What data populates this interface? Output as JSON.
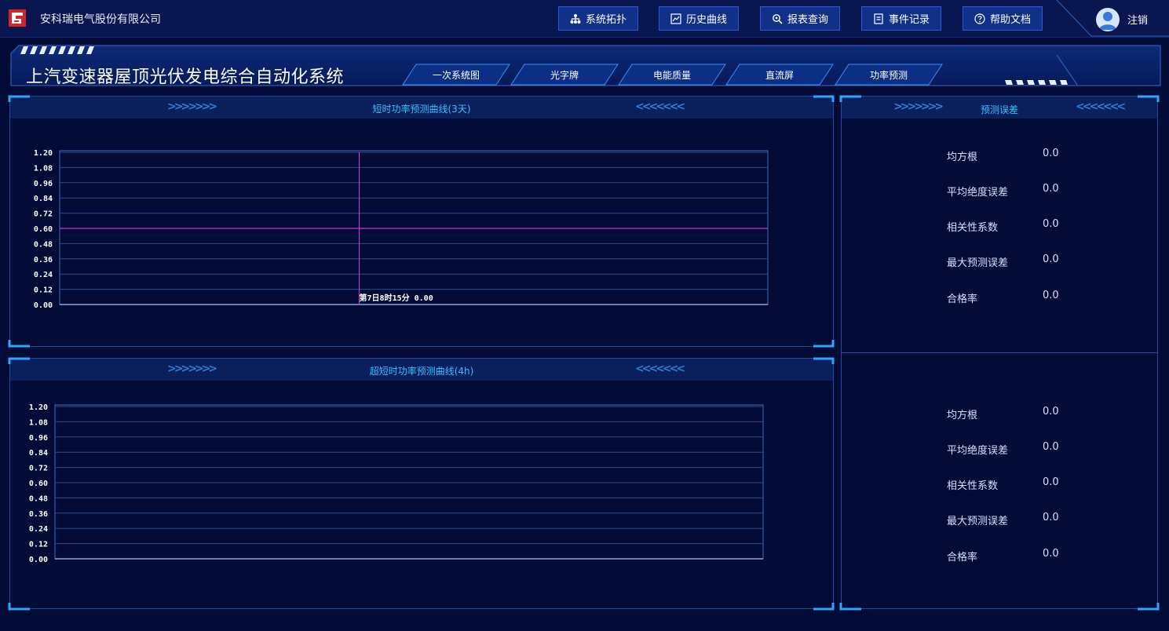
{
  "header": {
    "company": "安科瑞电气股份有限公司",
    "nav": [
      {
        "label": "系统拓扑",
        "icon": "topology-icon"
      },
      {
        "label": "历史曲线",
        "icon": "line-chart-icon"
      },
      {
        "label": "报表查询",
        "icon": "search-icon"
      },
      {
        "label": "事件记录",
        "icon": "document-icon"
      },
      {
        "label": "帮助文档",
        "icon": "help-icon"
      }
    ],
    "logout": "注销"
  },
  "system_title": "上汽变速器屋顶光伏发电综合自动化系统",
  "tabs": [
    "一次系统图",
    "光字牌",
    "电能质量",
    "直流屏",
    "功率预测"
  ],
  "panels": {
    "short_term": {
      "title": "短时功率预测曲线(3天)"
    },
    "ultra_short": {
      "title": "超短时功率预测曲线(4h)"
    },
    "error": {
      "title": "预测误差"
    }
  },
  "error_metrics_short": [
    {
      "label": "均方根",
      "value": "0.0"
    },
    {
      "label": "平均绝度误差",
      "value": "0.0"
    },
    {
      "label": "相关性系数",
      "value": "0.0"
    },
    {
      "label": "最大预测误差",
      "value": "0.0"
    },
    {
      "label": "合格率",
      "value": "0.0"
    }
  ],
  "error_metrics_ultra": [
    {
      "label": "均方根",
      "value": "0.0"
    },
    {
      "label": "平均绝度误差",
      "value": "0.0"
    },
    {
      "label": "相关性系数",
      "value": "0.0"
    },
    {
      "label": "最大预测误差",
      "value": "0.0"
    },
    {
      "label": "合格率",
      "value": "0.0"
    }
  ],
  "colors": {
    "accent": "#35c1ff",
    "crosshair": "#c23ad6",
    "border": "#1d4c9c"
  },
  "chart_data": [
    {
      "type": "line",
      "title": "短时功率预测曲线(3天)",
      "yticks": [
        "1.20",
        "1.08",
        "0.96",
        "0.84",
        "0.72",
        "0.60",
        "0.48",
        "0.36",
        "0.24",
        "0.12",
        "0.00"
      ],
      "ylim": [
        0,
        1.2
      ],
      "grid": true,
      "series": [],
      "crosshair": {
        "y": 0.6,
        "x_fraction": 0.423
      },
      "tooltip": "第7日8时15分  0.00"
    },
    {
      "type": "line",
      "title": "超短时功率预测曲线(4h)",
      "yticks": [
        "1.20",
        "1.08",
        "0.96",
        "0.84",
        "0.72",
        "0.60",
        "0.48",
        "0.36",
        "0.24",
        "0.12",
        "0.00"
      ],
      "ylim": [
        0,
        1.2
      ],
      "grid": true,
      "series": []
    }
  ]
}
